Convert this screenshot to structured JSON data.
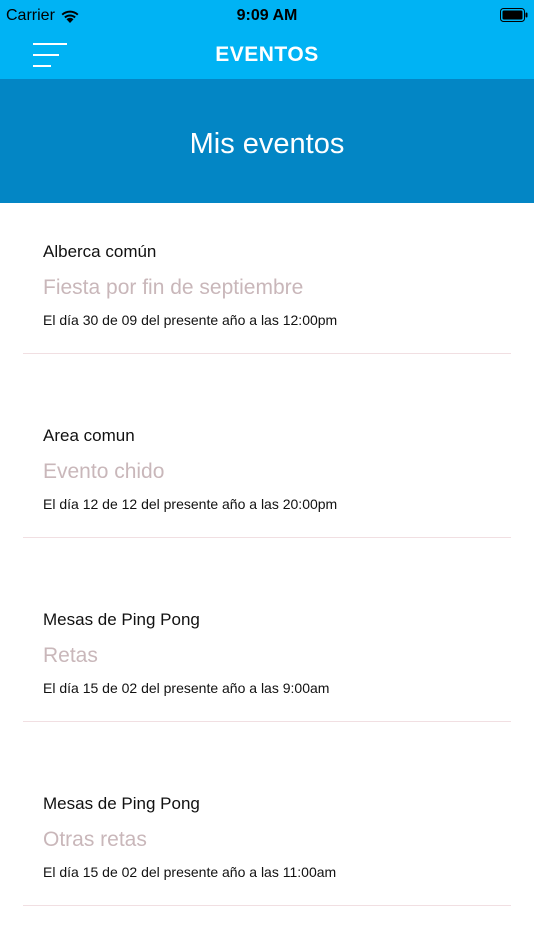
{
  "status_bar": {
    "carrier": "Carrier",
    "time": "9:09 AM",
    "icons": [
      "wifi-icon",
      "battery-icon"
    ]
  },
  "nav": {
    "title": "EVENTOS",
    "menu_icon": "hamburger-menu-icon"
  },
  "header": {
    "title": "Mis eventos"
  },
  "events": [
    {
      "location": "Alberca común",
      "name": "Fiesta por fin de septiembre",
      "date": "El día 30 de 09 del presente año a las 12:00pm"
    },
    {
      "location": "Area comun",
      "name": "Evento chido",
      "date": "El día 12 de 12 del presente año a las 20:00pm"
    },
    {
      "location": "Mesas de Ping Pong",
      "name": "Retas",
      "date": "El día 15 de 02 del presente año a las 9:00am"
    },
    {
      "location": "Mesas de Ping Pong",
      "name": "Otras retas",
      "date": "El día 15 de 02 del presente año a las 11:00am"
    }
  ],
  "colors": {
    "nav_background": "#00b3f4",
    "header_background": "#0386c5",
    "event_name": "#c9b7ba",
    "divider": "#f1dfe2"
  }
}
